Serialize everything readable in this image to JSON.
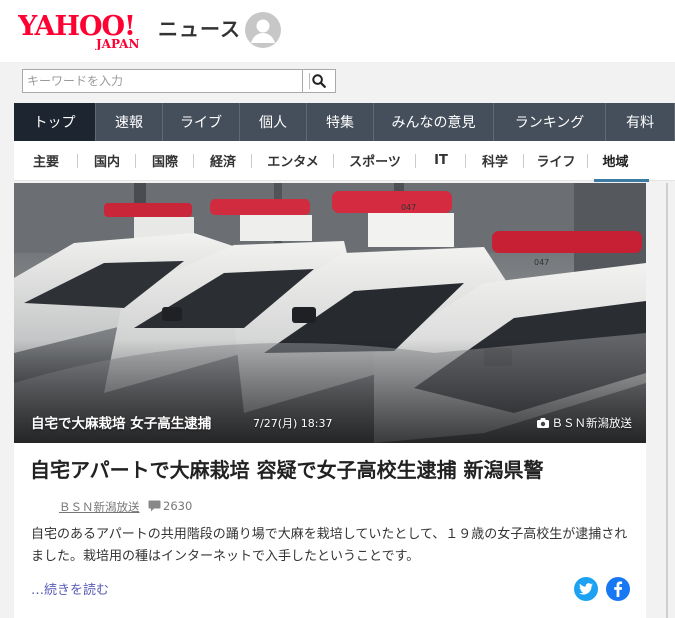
{
  "header": {
    "logo_text": "YAHOO!",
    "logo_sub": "JAPAN",
    "service_name": "ニュース",
    "colors": {
      "logo_red": "#ff0033"
    }
  },
  "search": {
    "placeholder": "キーワードを入力",
    "value": "",
    "button_icon": "search-icon"
  },
  "main_nav": {
    "tabs": [
      {
        "label": "トップ",
        "active": true
      },
      {
        "label": "速報"
      },
      {
        "label": "ライブ"
      },
      {
        "label": "個人"
      },
      {
        "label": "特集"
      },
      {
        "label": "みんなの意見"
      },
      {
        "label": "ランキング"
      },
      {
        "label": "有料"
      }
    ]
  },
  "sub_nav": {
    "items": [
      {
        "label": "主要"
      },
      {
        "label": "国内"
      },
      {
        "label": "国際"
      },
      {
        "label": "経済"
      },
      {
        "label": "エンタメ"
      },
      {
        "label": "スポーツ"
      },
      {
        "label": "IT"
      },
      {
        "label": "科学"
      },
      {
        "label": "ライフ"
      },
      {
        "label": "地域",
        "active": true
      }
    ]
  },
  "article": {
    "photo": {
      "caption_title": "自宅で大麻栽培 女子高生逮捕",
      "date": "7/27(月) 18:37",
      "credit": "ＢＳＮ新潟放送",
      "car_numbers": [
        "047",
        "047",
        "047"
      ]
    },
    "headline": "自宅アパートで大麻栽培 容疑で女子高校生逮捕 新潟県警",
    "source": "ＢＳＮ新潟放送",
    "comment_count": "2630",
    "summary": "自宅のあるアパートの共用階段の踊り場で大麻を栽培していたとして、１９歳の女子高校生が逮捕されました。栽培用の種はインターネットで入手したということです。",
    "read_more": "…続きを読む",
    "share": {
      "twitter_icon": "twitter-icon",
      "facebook_icon": "facebook-icon"
    }
  }
}
